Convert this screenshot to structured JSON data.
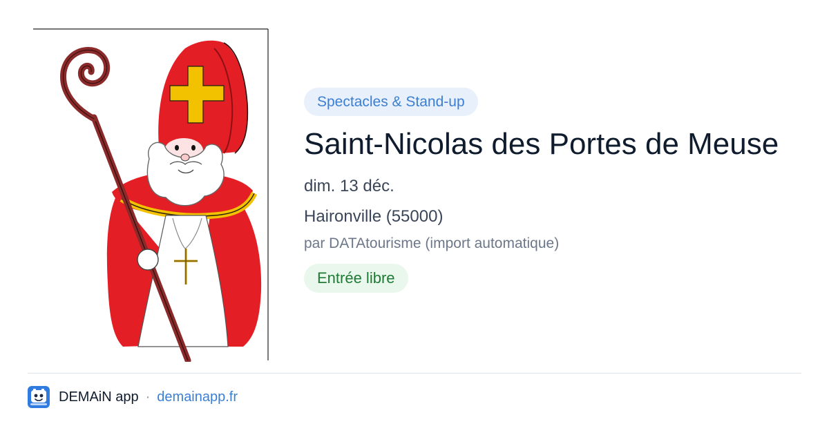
{
  "event": {
    "category": "Spectacles & Stand-up",
    "title": "Saint-Nicolas des Portes de Meuse",
    "date": "dim. 13 déc.",
    "location": "Haironville (55000)",
    "source": "par DATAtourisme (import automatique)",
    "price": "Entrée libre"
  },
  "footer": {
    "app_name": "DEMAiN app",
    "separator": "·",
    "site": "demainapp.fr"
  },
  "colors": {
    "category_badge_bg": "#e8f0fb",
    "category_badge_text": "#3b7fd4",
    "price_badge_bg": "#e9f7ec",
    "price_badge_text": "#1f7a35",
    "title_text": "#0f1c2e",
    "link": "#3b7fd4"
  },
  "icons": {
    "illustration": "saint-nicolas-illustration",
    "app_logo": "demain-app-logo-icon"
  }
}
